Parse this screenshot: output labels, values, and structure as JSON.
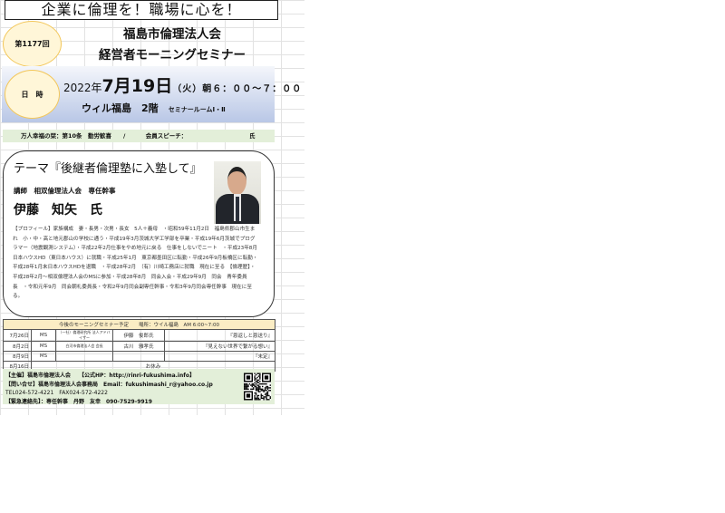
{
  "slogan": "企業に倫理を！職場に心を！",
  "session": "第1177回",
  "org": "福島市倫理法人会",
  "event": "経営者モーニングセミナー",
  "datetime_label": "日　時",
  "date": {
    "year": "2022年",
    "day": "7月19日",
    "rest": "（火）朝６：００～７：００"
  },
  "venue": {
    "main": "ウィル福島　2階",
    "room": "セミナールームⅠ・Ⅱ"
  },
  "info_row": {
    "left": "万人幸福の栞：第10条　勤労歓喜　　/",
    "speech": "会員スピーチ：",
    "suffix": "氏"
  },
  "theme": "テーマ『後継者倫理塾に入塾して』",
  "lecturer_title": "講師　相双倫理法人会　専任幹事",
  "lecturer_name": "伊藤　知矢　氏",
  "profile": "【プロフィール】家族構成　妻・長男・次男・長女　5人＋義母　・昭和59年11月2日　福島県郡山市生まれ　小・中・高と地元郡山の学校に通う・平成19年3月茨城大学工学部を卒業・平成19年6月茨城でプログラマー（地震観測システム）・平成22年2月仕事をやめ地元に戻る　仕事をしないでニート　・平成23年8月　日本ハウスHD（東日本ハウス）に就職・平成25年1月　東京都墨田区に転勤・平成26年9月板橋区に転勤・平成28年1月末日本ハウスHDを退職　・平成28年2月　（有）川崎工務店に就職　現在に至る　【倫理歴】・平成28年2月～相双倫理法人会のMSに参加・平成28年8月　同会入会・平成29年9月　同会　青年委員長　・令和元年9月　同会朝礼委員長・令和2年9月同会副専任幹事・令和3年9月同会専任幹事　現在に至る。",
  "schedule": {
    "header": "今後のモーニングセミナー予定　　場所：ウイル福島　AM 6:00~7:00",
    "rows": [
      {
        "date": "7月26日",
        "type": "MS",
        "org": "（一社）倫理研究所 法人アドバイザー",
        "speaker": "伊藤　俊郎氏",
        "title": "『恩返しと恩送り』"
      },
      {
        "date": "8月2日",
        "type": "MS",
        "org": "白河市倫理法人会 会長",
        "speaker": "古川　雅孝氏",
        "title": "『見えない世界で繋がる想い』"
      },
      {
        "date": "8月9日",
        "type": "MS",
        "org": "",
        "speaker": "",
        "title": "『未定』"
      },
      {
        "date": "8月16日",
        "note": "お休み"
      }
    ]
  },
  "footer": {
    "host": "【主催】福島市倫理法人会　　【公式HP：http://rinri-fukushima.info】",
    "contact": "【問い合せ】福島市倫理法人会事務局　Email：fukushimashi_r@yahoo.co.jp",
    "tel": "TEL024-572-4221　FAX024-572-4222",
    "emergency": "【緊急連絡先】：専任幹事　丹野　友幸　090-7529-9919"
  },
  "colors": {
    "circle": "#fff6d8",
    "band": "#b9c7e6",
    "green": "#e3efd9",
    "table_header": "#fbedc4"
  }
}
